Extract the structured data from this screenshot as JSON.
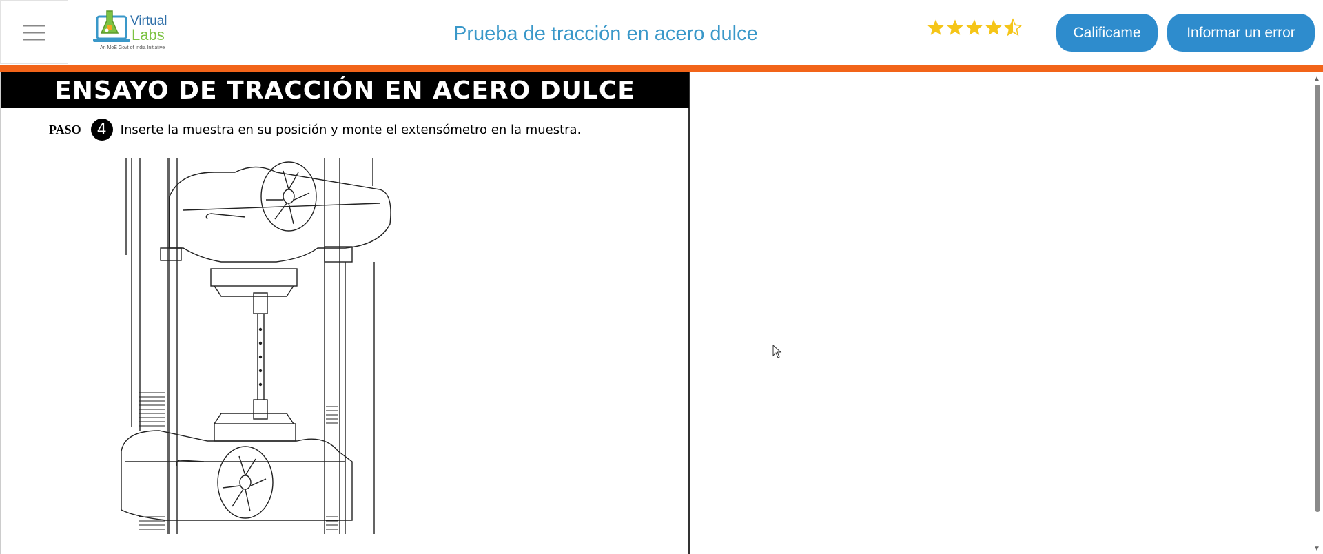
{
  "header": {
    "menu_icon": "hamburger-icon",
    "logo": {
      "line1": "Virtual",
      "line2": "Labs",
      "tagline": "An MoE Govt of India Initiative"
    },
    "title": "Prueba de tracción en acero dulce",
    "rating": 4.5,
    "rate_button": "Calificame",
    "report_button": "Informar un error"
  },
  "colors": {
    "accent_orange": "#f26419",
    "button_blue": "#2e8ccd",
    "title_blue": "#3a98c9",
    "star_gold": "#f5c518"
  },
  "simulation": {
    "heading": "ENSAYO DE TRACCIÓN EN ACERO DULCE",
    "step_label": "PASO",
    "step_number": "4",
    "step_text": "Inserte la muestra en su posición y monte el extensómetro en la muestra."
  }
}
